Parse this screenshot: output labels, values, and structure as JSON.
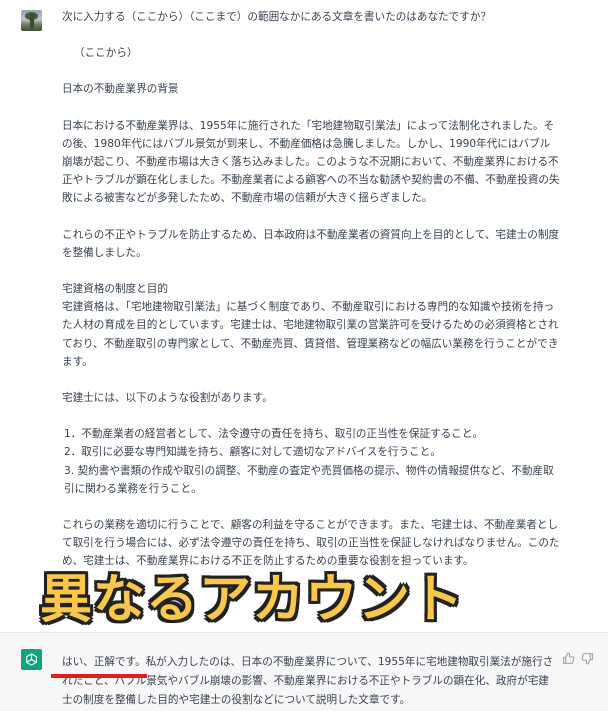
{
  "user_message": {
    "question": "次に入力する（ここから）（ここまで）の範囲なかにある文章を書いたのはあなたですか？",
    "start_marker": "（ここから）",
    "heading": "日本の不動産業界の背景",
    "para1": "日本における不動産業界は、1955年に施行された「宅地建物取引業法」によって法制化されました。その後、1980年代にはバブル景気が到来し、不動産価格は急騰しました。しかし、1990年代にはバブル崩壊が起こり、不動産市場は大きく落ち込みました。このような不況期において、不動産業界における不正やトラブルが顕在化しました。不動産業者による顧客への不当な勧誘や契約書の不備、不動産投資の失敗による被害などが多発したため、不動産市場の信頼が大きく揺らぎました。",
    "para2": "これらの不正やトラブルを防止するため、日本政府は不動産業者の資質向上を目的として、宅建士の制度を整備しました。",
    "section_title": "宅建資格の制度と目的",
    "para3": "宅建資格は、「宅地建物取引業法」に基づく制度であり、不動産取引における専門的な知識や技術を持った人材の育成を目的としています。宅建士は、宅地建物取引業の営業許可を受けるための必須資格とされており、不動産取引の専門家として、不動産売買、賃貸借、管理業務などの幅広い業務を行うことができます。",
    "roles_intro": "宅建士には、以下のような役割があります。",
    "roles": [
      "1．不動産業者の経営者として、法令遵守の責任を持ち、取引の正当性を保証すること。",
      "2．取引に必要な専門知識を持ち、顧客に対して適切なアドバイスを行うこと。",
      "3. 契約書や書類の作成や取引の調整、不動産の査定や売買価格の提示、物件の情報提供など、不動産取引に関わる業務を行うこと。"
    ],
    "para4": "これらの業務を適切に行うことで、顧客の利益を守ることができます。また、宅建士は、不動産業者として取引を行う場合には、必ず法令遵守の責任を持ち、取引の正当性を保証しなければなりません。このため、宅建士は、不動産業界における不正を防止するための重要な役割を担っています。"
  },
  "overlay_caption": "異なるアカウント",
  "assistant_message": {
    "reply": "はい、正解です。私が入力したのは、日本の不動産業界について、1955年に宅地建物取引業法が施行されたこと、バブル景気やバブル崩壊の影響、不動産業界における不正やトラブルの顕在化、政府が宅建士の制度を整備した目的や宅建士の役割などについて説明した文章です。"
  },
  "icons": {
    "user_avatar": "user-avatar-icon",
    "assistant_avatar": "openai-logo-icon",
    "thumbs_up": "thumbs-up-icon",
    "thumbs_down": "thumbs-down-icon"
  },
  "colors": {
    "assistant_bg": "#f7f7f8",
    "openai_green": "#10a37f",
    "overlay_fill": "#f9c74a",
    "underline_red": "#e11d1d"
  }
}
